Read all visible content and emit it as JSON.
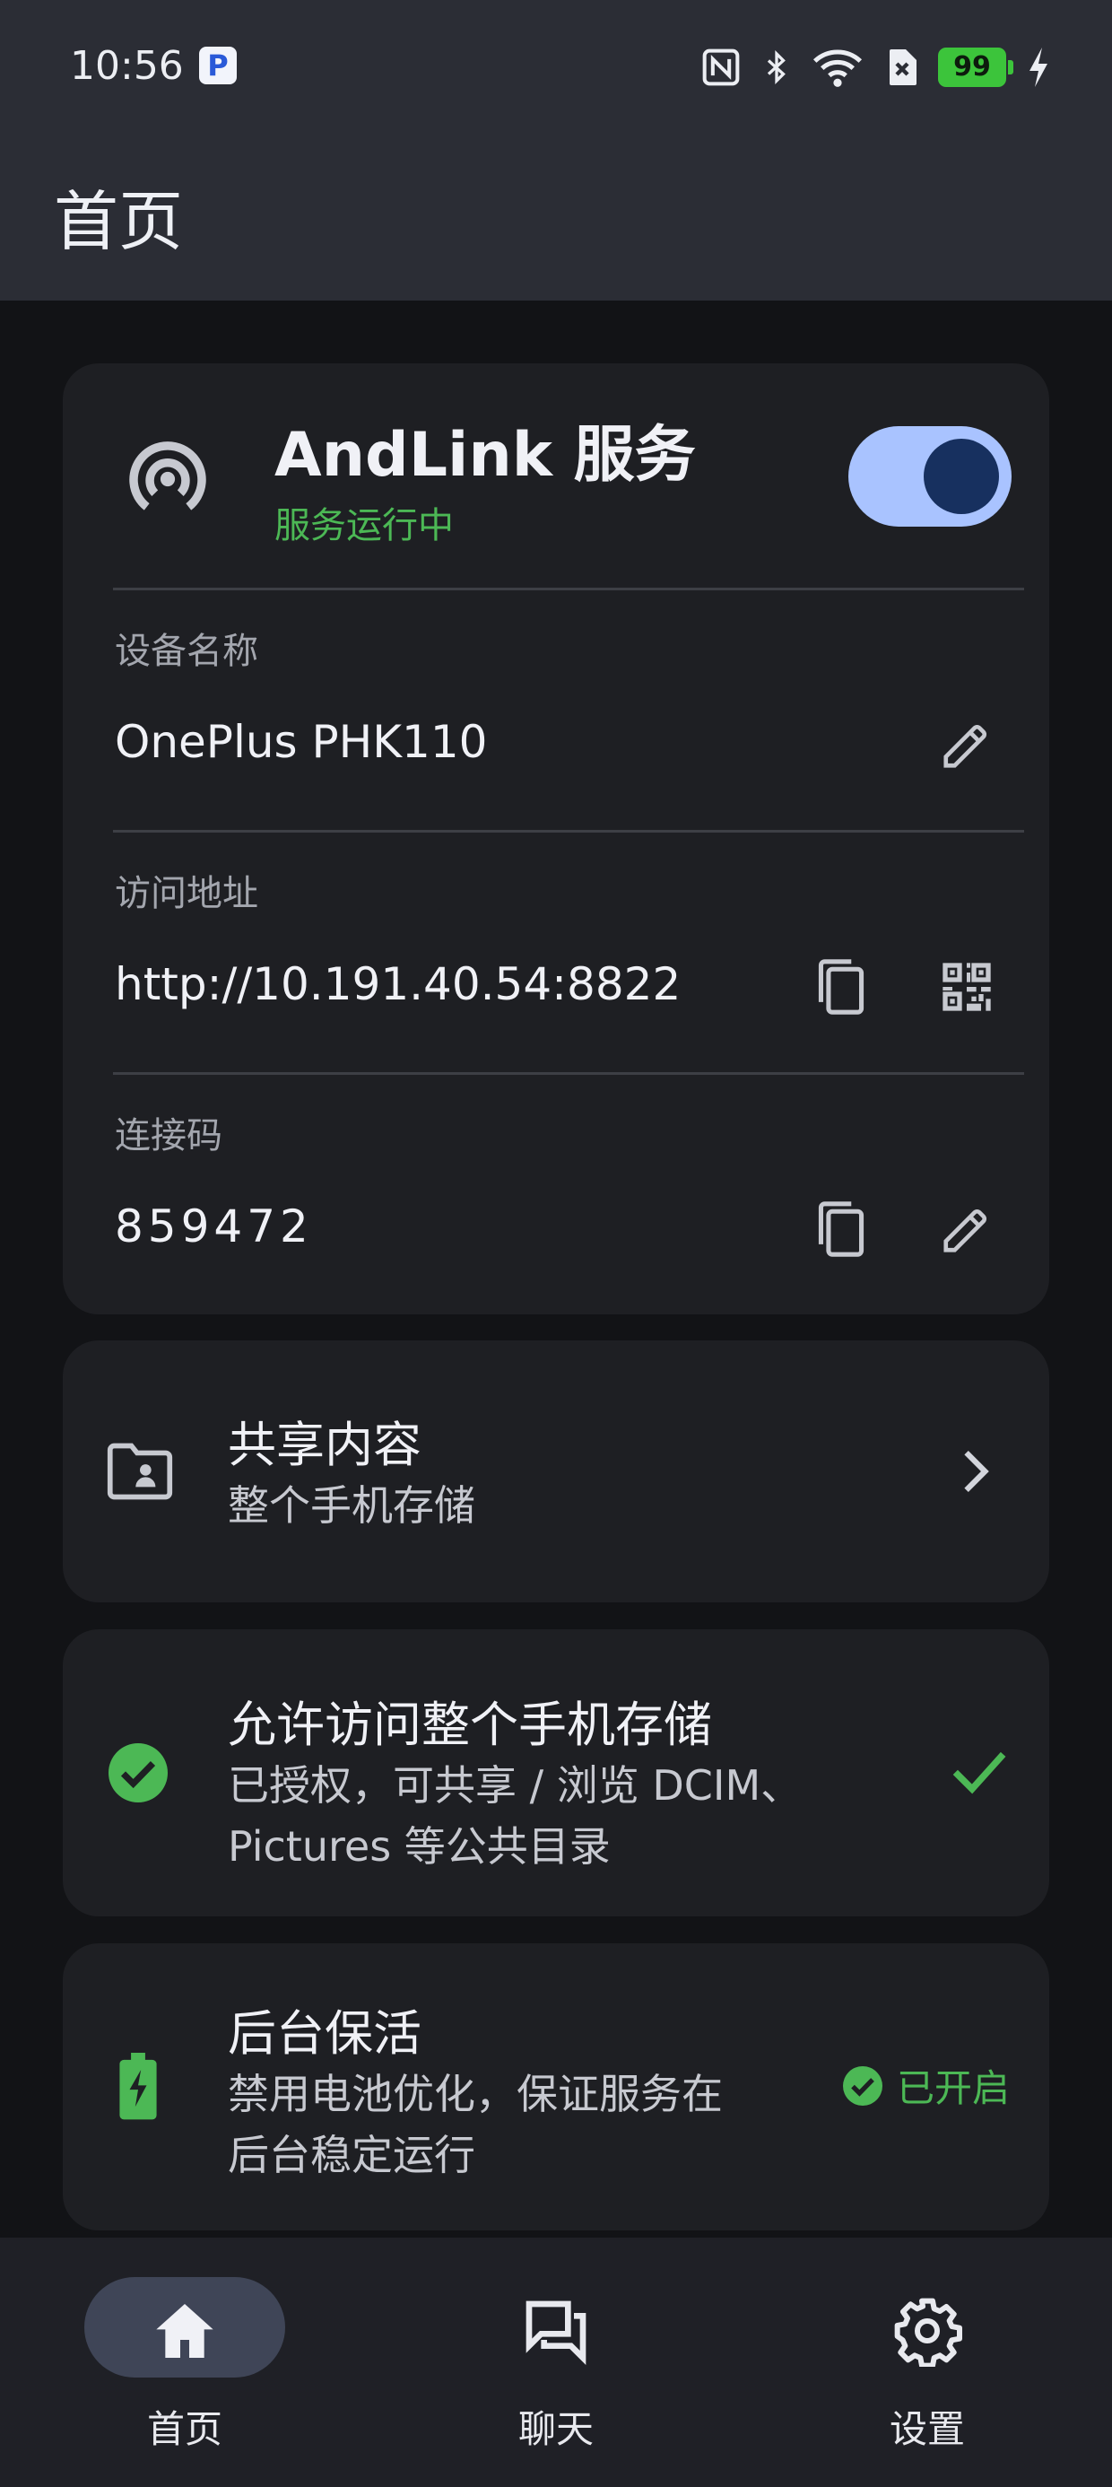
{
  "status_bar": {
    "time": "10:56",
    "app_icon_letter": "P",
    "battery_level": "99",
    "icons": [
      "nfc-icon",
      "bluetooth-icon",
      "wifi-icon",
      "sim-off-icon",
      "battery-icon",
      "charging-icon"
    ]
  },
  "top_bar": {
    "title": "首页"
  },
  "service_card": {
    "title": "AndLink 服务",
    "status": "服务运行中",
    "toggle_on": true,
    "device_name_label": "设备名称",
    "device_name_value": "OnePlus PHK110",
    "address_label": "访问地址",
    "address_value": "http://10.191.40.54:8822",
    "code_label": "连接码",
    "code_value": "859472"
  },
  "share_card": {
    "title": "共享内容",
    "subtitle": "整个手机存储"
  },
  "storage_card": {
    "title": "允许访问整个手机存储",
    "subtitle_line1": "已授权，可共享 / 浏览 DCIM、",
    "subtitle_line2": "Pictures 等公共目录"
  },
  "background_card": {
    "title": "后台保活",
    "subtitle_line1": "禁用电池优化，保证服务在",
    "subtitle_line2": "后台稳定运行",
    "badge": "已开启"
  },
  "bottom_nav": {
    "items": [
      {
        "label": "首页",
        "icon": "home-icon",
        "active": true
      },
      {
        "label": "聊天",
        "icon": "chat-icon",
        "active": false
      },
      {
        "label": "设置",
        "icon": "gear-icon",
        "active": false
      }
    ]
  },
  "colors": {
    "background": "#121316",
    "card": "#1e1f23",
    "accent_green": "#4cb855",
    "toggle_track": "#a9c3ff",
    "toggle_knob": "#17305f"
  }
}
